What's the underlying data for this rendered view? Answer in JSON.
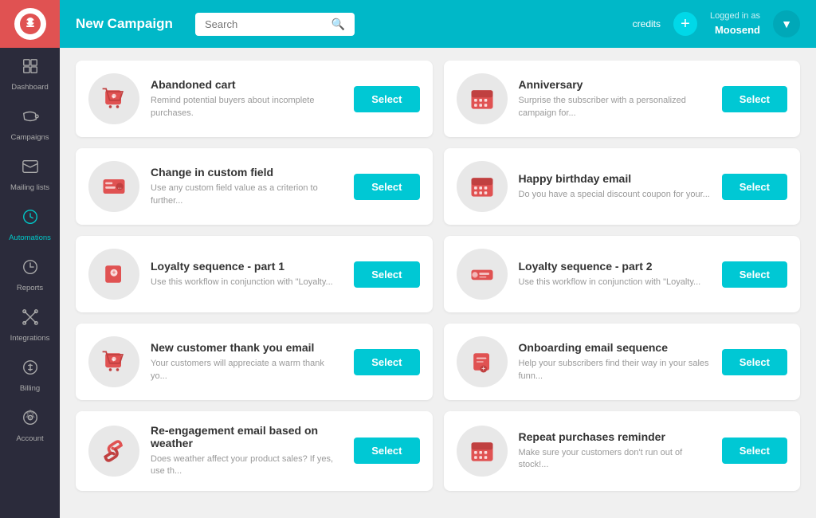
{
  "sidebar": {
    "items": [
      {
        "id": "dashboard",
        "label": "Dashboard",
        "icon": "⊙",
        "active": false
      },
      {
        "id": "campaigns",
        "label": "Campaigns",
        "icon": "📣",
        "active": false
      },
      {
        "id": "mailing-lists",
        "label": "Mailing lists",
        "icon": "✉",
        "active": false
      },
      {
        "id": "automations",
        "label": "Automations",
        "icon": "🕐",
        "active": true
      },
      {
        "id": "reports",
        "label": "Reports",
        "icon": "◷",
        "active": false
      },
      {
        "id": "integrations",
        "label": "Integrations",
        "icon": "✖",
        "active": false
      },
      {
        "id": "billing",
        "label": "Billing",
        "icon": "$",
        "active": false
      },
      {
        "id": "account",
        "label": "Account",
        "icon": "⚙",
        "active": false
      }
    ]
  },
  "topbar": {
    "title": "New Campaign",
    "search_placeholder": "Search",
    "credits_label": "credits",
    "logged_in_label": "Logged in as",
    "username": "Moosend"
  },
  "campaigns": [
    {
      "id": "abandoned-cart",
      "title": "Abandoned cart",
      "description": "Remind potential buyers about incomplete purchases.",
      "icon_type": "cart",
      "select_label": "Select"
    },
    {
      "id": "anniversary",
      "title": "Anniversary",
      "description": "Surprise the subscriber with a personalized campaign for...",
      "icon_type": "calendar",
      "select_label": "Select"
    },
    {
      "id": "change-custom-field",
      "title": "Change in custom field",
      "description": "Use any custom field value as a criterion to further...",
      "icon_type": "custom-field",
      "select_label": "Select"
    },
    {
      "id": "happy-birthday",
      "title": "Happy birthday email",
      "description": "Do you have a special discount coupon for your...",
      "icon_type": "calendar",
      "select_label": "Select"
    },
    {
      "id": "loyalty-1",
      "title": "Loyalty sequence - part 1",
      "description": "Use this workflow in conjunction with \"Loyalty...",
      "icon_type": "loyalty1",
      "select_label": "Select"
    },
    {
      "id": "loyalty-2",
      "title": "Loyalty sequence - part 2",
      "description": "Use this workflow in conjunction with \"Loyalty...",
      "icon_type": "loyalty2",
      "select_label": "Select"
    },
    {
      "id": "new-customer",
      "title": "New customer thank you email",
      "description": "Your customers will appreciate a warm thank yo...",
      "icon_type": "cart",
      "select_label": "Select"
    },
    {
      "id": "onboarding",
      "title": "Onboarding email sequence",
      "description": "Help your subscribers find their way in your sales funn...",
      "icon_type": "onboarding",
      "select_label": "Select"
    },
    {
      "id": "reengagement",
      "title": "Re-engagement email based on weather",
      "description": "Does weather affect your product sales? If yes, use th...",
      "icon_type": "link",
      "select_label": "Select"
    },
    {
      "id": "repeat-purchases",
      "title": "Repeat purchases reminder",
      "description": "Make sure your customers don't run out of stock!...",
      "icon_type": "calendar",
      "select_label": "Select"
    }
  ]
}
